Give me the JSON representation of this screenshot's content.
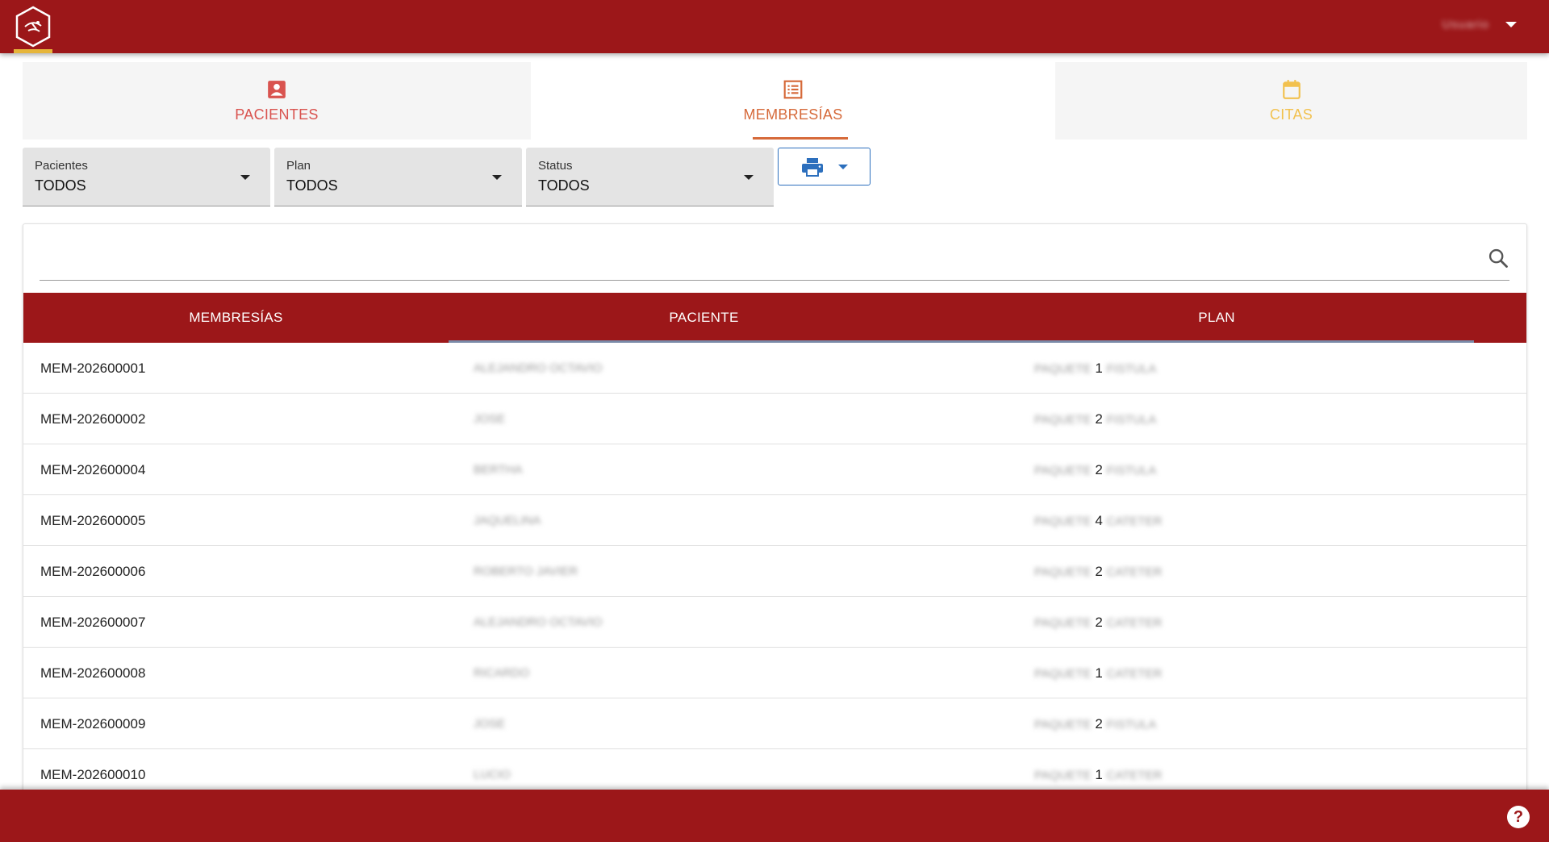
{
  "header": {
    "user_name": "Usuario",
    "logo_icon": "hexagon-logo-icon"
  },
  "tabs": [
    {
      "label": "PACIENTES",
      "icon": "contact-card-icon",
      "color": "#d9534f",
      "active": false
    },
    {
      "label": "MEMBRESÍAS",
      "icon": "list-document-icon",
      "color": "#d66a3a",
      "active": true
    },
    {
      "label": "CITAS",
      "icon": "calendar-icon",
      "color": "#f2c14e",
      "active": false
    }
  ],
  "filters": {
    "pacientes": {
      "label": "Pacientes",
      "value": "TODOS"
    },
    "plan": {
      "label": "Plan",
      "value": "TODOS"
    },
    "status": {
      "label": "Status",
      "value": "TODOS"
    },
    "print_icon": "printer-icon"
  },
  "search": {
    "placeholder": "",
    "value": ""
  },
  "table": {
    "columns": [
      "MEMBRESÍAS",
      "PACIENTE",
      "PLAN"
    ],
    "rows": [
      {
        "id": "MEM-202600001",
        "patient": "ALEJANDRO OCTAVIO",
        "plan_prefix": "PAQUETE",
        "plan_num": "1",
        "plan_type": "FISTULA"
      },
      {
        "id": "MEM-202600002",
        "patient": "JOSE",
        "plan_prefix": "PAQUETE",
        "plan_num": "2",
        "plan_type": "FISTULA"
      },
      {
        "id": "MEM-202600004",
        "patient": "BERTHA",
        "plan_prefix": "PAQUETE",
        "plan_num": "2",
        "plan_type": "FISTULA"
      },
      {
        "id": "MEM-202600005",
        "patient": "JAQUELINA",
        "plan_prefix": "PAQUETE",
        "plan_num": "4",
        "plan_type": "CATETER"
      },
      {
        "id": "MEM-202600006",
        "patient": "ROBERTO JAVIER",
        "plan_prefix": "PAQUETE",
        "plan_num": "2",
        "plan_type": "CATETER"
      },
      {
        "id": "MEM-202600007",
        "patient": "ALEJANDRO OCTAVIO",
        "plan_prefix": "PAQUETE",
        "plan_num": "2",
        "plan_type": "CATETER"
      },
      {
        "id": "MEM-202600008",
        "patient": "RICARDO",
        "plan_prefix": "PAQUETE",
        "plan_num": "1",
        "plan_type": "CATETER"
      },
      {
        "id": "MEM-202600009",
        "patient": "JOSE",
        "plan_prefix": "PAQUETE",
        "plan_num": "2",
        "plan_type": "FISTULA"
      },
      {
        "id": "MEM-202600010",
        "patient": "LUCIO",
        "plan_prefix": "PAQUETE",
        "plan_num": "1",
        "plan_type": "CATETER"
      }
    ]
  },
  "footer": {
    "help_label": "?"
  },
  "colors": {
    "brand": "#9c1719",
    "accent_blue": "#2c6fbd",
    "logo_accent": "#e6b53a"
  }
}
